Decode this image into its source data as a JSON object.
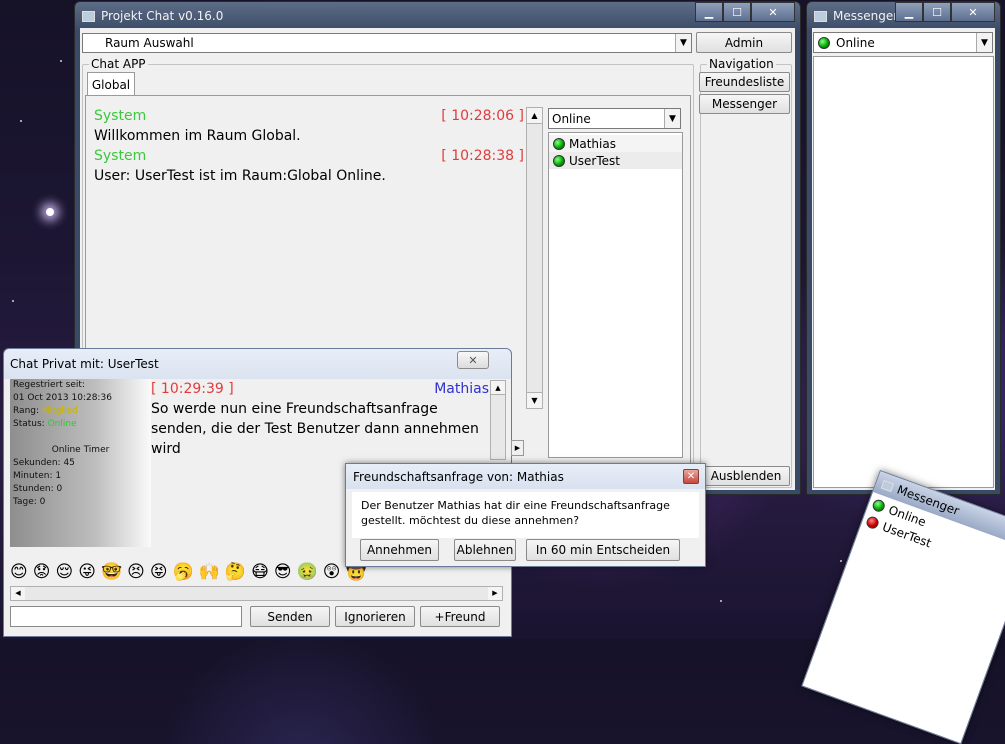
{
  "main_window": {
    "title": "Projekt Chat v0.16.0",
    "room_select": "Raum Auswahl",
    "admin_label": "Admin",
    "chat_group_label": "Chat APP",
    "tab_global": "Global",
    "messages": [
      {
        "sender": "System",
        "time": "[ 10:28:06 ]",
        "text": "Willkommen im Raum Global."
      },
      {
        "sender": "System",
        "time": "[ 10:28:38 ]",
        "text": "User: UserTest ist im Raum:Global Online."
      }
    ],
    "status_select": "Online",
    "users": [
      "Mathias",
      "UserTest"
    ],
    "nav_group_label": "Navigation",
    "friendlist_label": "Freundesliste",
    "messenger_label": "Messenger",
    "hide_label": "Ausblenden"
  },
  "messenger_window": {
    "title": "Messenger",
    "status_select": "Online"
  },
  "private_chat": {
    "title": "Chat Privat mit: UserTest",
    "info": {
      "registered_label": "Regestriert seit:",
      "registered_date": "01 Oct 2013 10:28:36",
      "rank_label": "Rang:",
      "rank_value": "Mitglied",
      "status_label": "Status:",
      "status_value": "Online",
      "timer_title": "Online Timer",
      "seconds": "Sekunden: 45",
      "minutes": "Minuten: 1",
      "hours": "Stunden: 0",
      "days": "Tage: 0"
    },
    "message": {
      "time": "[ 10:29:39 ]",
      "sender": "Mathias",
      "lines": [
        "So werde nun eine Freundschaftsanfrage",
        "senden, die der Test Benutzer dann annehmen",
        "wird"
      ]
    },
    "input_value": "",
    "send_label": "Senden",
    "ignore_label": "Ignorieren",
    "add_friend_label": "+Freund",
    "emojis": [
      "😊",
      "😟",
      "😌",
      "😜",
      "🤓",
      "😣",
      "😝",
      "🥱",
      "🙌",
      "🤔",
      "😷",
      "😎",
      "🤢",
      "😲",
      "🤠"
    ]
  },
  "friend_dialog": {
    "title": "Freundschaftsanfrage von: Mathias",
    "message_line1": "Der Benutzer Mathias hat dir eine Freundschaftsanfrage",
    "message_line2": "gestellt. möchtest du diese annehmen?",
    "accept_label": "Annehmen",
    "decline_label": "Ablehnen",
    "later_label": "In 60 min Entscheiden"
  },
  "mini_messenger": {
    "title": "Messenger",
    "contacts": [
      {
        "name": "Online",
        "status": "online"
      },
      {
        "name": "UserTest",
        "status": "offline"
      }
    ]
  },
  "colors": {
    "system_green": "#3cc83c",
    "time_red": "#e03c3c",
    "sender_blue": "#3030d0",
    "rank_gold": "#c8b400",
    "status_green": "#2ecc2e"
  }
}
